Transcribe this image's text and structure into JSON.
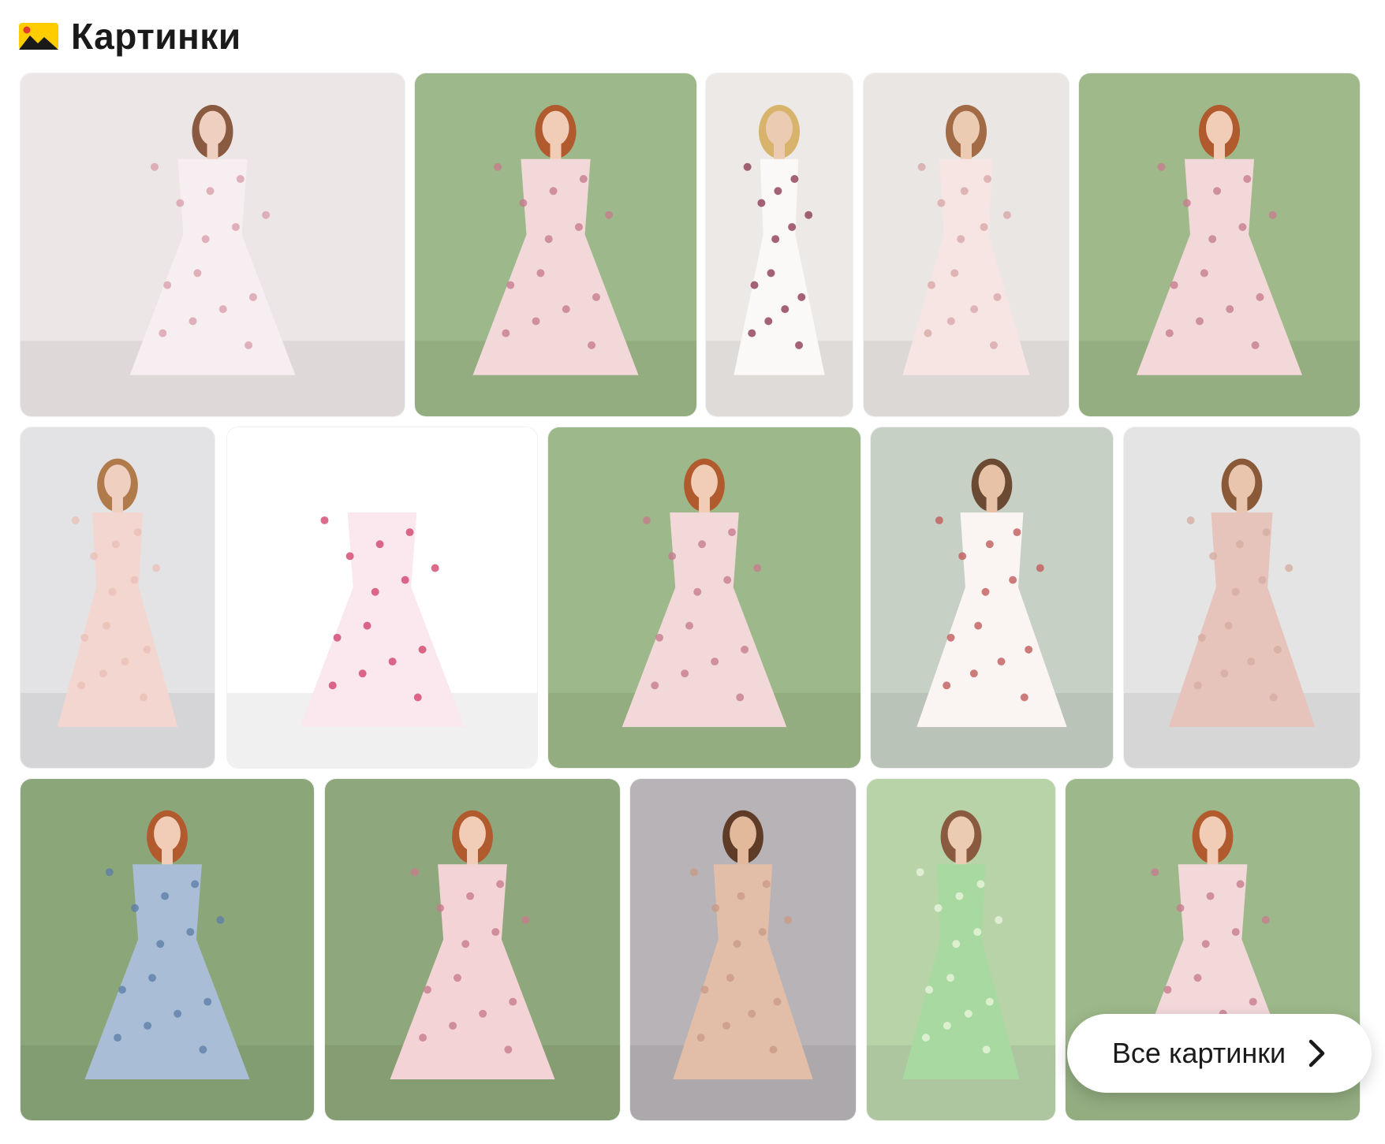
{
  "header": {
    "title": "Картинки",
    "logo_icon": "yandex-images-icon"
  },
  "colors": {
    "accent_yellow": "#ffcc00",
    "text": "#1a1a1a"
  },
  "all_button": {
    "label": "Все картинки",
    "icon": "chevron-right-icon"
  },
  "tiles": [
    {
      "bg": "#ece6e6",
      "dress": "#f6eef0",
      "accent": "#d9a0ad",
      "skin": "#efcfbf",
      "hair": "#8a5a40"
    },
    {
      "bg": "#9db88a",
      "dress": "#f3d8da",
      "accent": "#c77d8d",
      "skin": "#f1cdb8",
      "hair": "#b05a2e"
    },
    {
      "bg": "#ece9e7",
      "dress": "#fbf8f8",
      "accent": "#8e3c55",
      "skin": "#eccbb3",
      "hair": "#d8b36b"
    },
    {
      "bg": "#e9e6e4",
      "dress": "#f6e5e3",
      "accent": "#d9a7a9",
      "skin": "#eccbb3",
      "hair": "#a26a45"
    },
    {
      "bg": "#9fb98a",
      "dress": "#f3d8da",
      "accent": "#c77d8d",
      "skin": "#f1cdb8",
      "hair": "#b05a2e"
    },
    {
      "bg": "#e3e3e5",
      "dress": "#f3d6cf",
      "accent": "#e8c0b6",
      "skin": "#efcfbf",
      "hair": "#b07a4a"
    },
    {
      "bg": "#ffffff",
      "dress": "#fbe7ee",
      "accent": "#d3456f",
      "skin": "#ffffff",
      "hair": "#ffffff"
    },
    {
      "bg": "#9db88a",
      "dress": "#f3d8da",
      "accent": "#c77d8d",
      "skin": "#f1cdb8",
      "hair": "#b05a2e"
    },
    {
      "bg": "#c6d0c4",
      "dress": "#faf5f2",
      "accent": "#c25b5b",
      "skin": "#e8c2a6",
      "hair": "#6a4a33"
    },
    {
      "bg": "#e4e4e4",
      "dress": "#e6c3bb",
      "accent": "#d6aca3",
      "skin": "#e9c5ad",
      "hair": "#8a5a38"
    },
    {
      "bg": "#8ba77a",
      "dress": "#a9bdd6",
      "accent": "#5f7fa8",
      "skin": "#f1cdb8",
      "hair": "#b05a2e"
    },
    {
      "bg": "#8fa77c",
      "dress": "#f3d3d6",
      "accent": "#c77d8d",
      "skin": "#f1cdb8",
      "hair": "#b05a2e"
    },
    {
      "bg": "#b7b3b6",
      "dress": "#e2bea9",
      "accent": "#c99b85",
      "skin": "#e3b99c",
      "hair": "#5e3c28"
    },
    {
      "bg": "#b9d3a9",
      "dress": "#a8d9a0",
      "accent": "#e9f5dc",
      "skin": "#eccbb3",
      "hair": "#8a5a40"
    },
    {
      "bg": "#9db88a",
      "dress": "#f3d8da",
      "accent": "#c77d8d",
      "skin": "#f1cdb8",
      "hair": "#b05a2e"
    }
  ]
}
